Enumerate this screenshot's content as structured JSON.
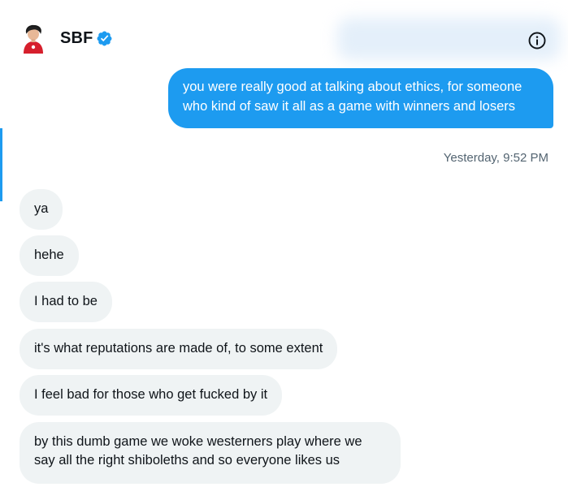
{
  "header": {
    "title": "SBF",
    "avatar_icon": "avatar-icon",
    "verified_icon": "verified-badge-icon",
    "info_icon": "info-icon",
    "accent_color": "#1d9bf0"
  },
  "conversation": {
    "sent": {
      "text": "you were really good at talking about ethics, for someone who kind of saw it all as a game with winners and losers",
      "timestamp": "Yesterday, 9:52 PM"
    },
    "received": [
      {
        "text": "ya"
      },
      {
        "text": "hehe"
      },
      {
        "text": "I had to be"
      },
      {
        "text": "it's what reputations are made of, to some extent"
      },
      {
        "text": "I feel bad for those who get fucked by it"
      },
      {
        "text": "by this dumb game we woke westerners play where we say all the right shiboleths and so everyone likes us"
      }
    ]
  }
}
